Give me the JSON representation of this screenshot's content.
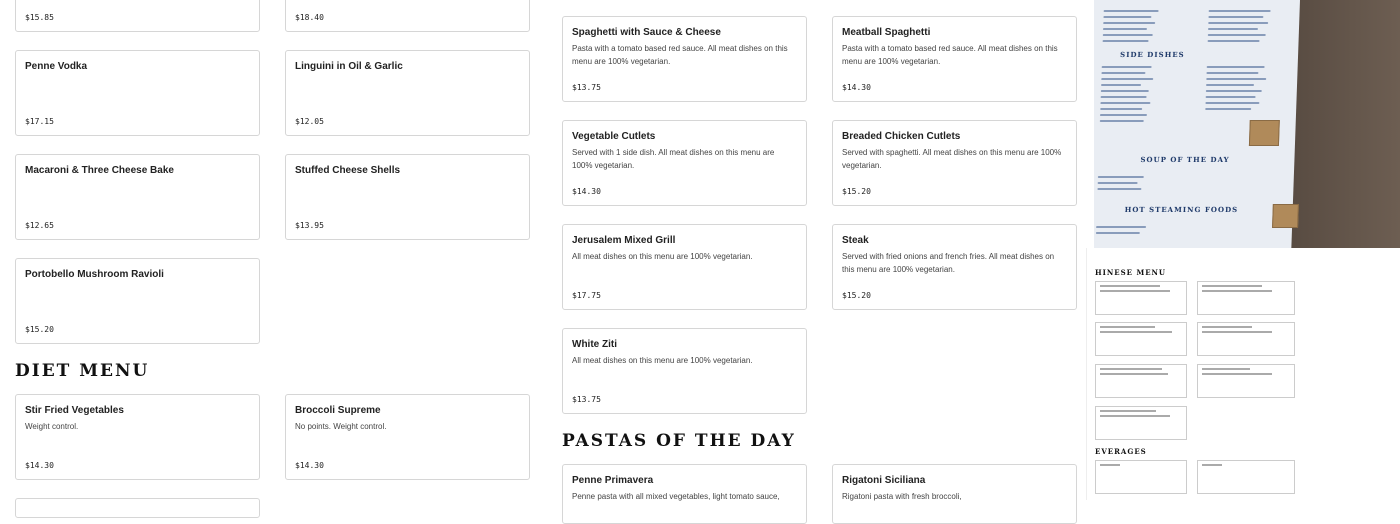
{
  "left_column_top": [
    {
      "price": "$15.85"
    },
    {
      "price": "$18.40"
    }
  ],
  "pasta_left": [
    {
      "name": "Penne Vodka",
      "price": "$17.15"
    },
    {
      "name": "Linguini in Oil & Garlic",
      "price": "$12.05"
    },
    {
      "name": "Macaroni & Three Cheese Bake",
      "price": "$12.65"
    },
    {
      "name": "Stuffed Cheese Shells",
      "price": "$13.95"
    },
    {
      "name": "Portobello Mushroom Ravioli",
      "price": "$15.20"
    }
  ],
  "diet_menu": {
    "title": "Diet Menu",
    "items": [
      {
        "name": "Stir Fried Vegetables",
        "desc": "Weight control.",
        "price": "$14.30"
      },
      {
        "name": "Broccoli Supreme",
        "desc": "No points. Weight control.",
        "price": "$14.30"
      }
    ]
  },
  "middle_items": [
    {
      "name": "Spaghetti with Sauce & Cheese",
      "desc": "Pasta with a tomato based red sauce. All meat dishes on this menu are 100% vegetarian.",
      "price": "$13.75"
    },
    {
      "name": "Meatball Spaghetti",
      "desc": "Pasta with a tomato based red sauce. All meat dishes on this menu are 100% vegetarian.",
      "price": "$14.30"
    },
    {
      "name": "Vegetable Cutlets",
      "desc": "Served with 1 side dish. All meat dishes on this menu are 100% vegetarian.",
      "price": "$14.30"
    },
    {
      "name": "Breaded Chicken Cutlets",
      "desc": "Served with spaghetti. All meat dishes on this menu are 100% vegetarian.",
      "price": "$15.20"
    },
    {
      "name": "Jerusalem Mixed Grill",
      "desc": "All meat dishes on this menu are 100% vegetarian.",
      "price": "$17.75"
    },
    {
      "name": "Steak",
      "desc": "Served with fried onions and french fries. All meat dishes on this menu are 100% vegetarian.",
      "price": "$15.20"
    },
    {
      "name": "White Ziti",
      "desc": "All meat dishes on this menu are 100% vegetarian.",
      "price": "$13.75"
    }
  ],
  "pastas_of_the_day": {
    "title": "Pastas of the Day",
    "items": [
      {
        "name": "Penne Primavera",
        "desc": "Penne pasta with all mixed vegetables, light tomato sauce,"
      },
      {
        "name": "Rigatoni Siciliana",
        "desc": "Rigatoni pasta with fresh broccoli,"
      }
    ]
  },
  "photo": {
    "sheet_sections": [
      "SIDE DISHES",
      "SOUP OF THE DAY",
      "HOT STEAMING FOODS"
    ]
  },
  "preview": {
    "sections": [
      "HINESE MENU",
      "EVERAGES"
    ]
  },
  "colors": {
    "card_border": "#d6d6d6",
    "background": "#ffffff",
    "menu_sheet_text": "#1f3a6a"
  }
}
